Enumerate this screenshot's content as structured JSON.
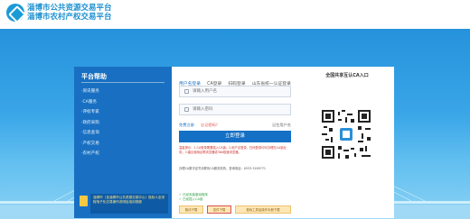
{
  "header": {
    "title_line1": "淄博市公共资源交易平台",
    "title_line2": "淄博市农村产权交易平台"
  },
  "sidebar": {
    "title": "平台帮助",
    "items": [
      {
        "label": "·资讯服务"
      },
      {
        "label": "·CA服务"
      },
      {
        "label": "·评标专家"
      },
      {
        "label": "·政府采购"
      },
      {
        "label": "·信息查询"
      },
      {
        "label": "·产权交易"
      },
      {
        "label": "·农村产权"
      }
    ],
    "notice": "淄博市（含淄博市公共资源交易中心）投标人全流程电子化交易操作说明及培训视频"
  },
  "login": {
    "tabs": [
      {
        "label": "用户名登录",
        "active": true
      },
      {
        "label": "CA登录",
        "active": false
      },
      {
        "label": "扫码登录",
        "active": false
      },
      {
        "label": "山东省统一认证登录",
        "active": false
      }
    ],
    "username_placeholder": "请输入用户名",
    "password_placeholder": "请输入密码",
    "register_link": "免费注册",
    "forgot_link": "忘记密码？",
    "remember_label": "记住用户名",
    "submit_label": "立即登录",
    "note1": "温馨提示：1.CA登录需要插入CA锁；2.用户名登录、扫码登录均可办理无CA锁业务；3.建议使用谷歌浏览器或360极速浏览器。",
    "note2": "办理CA数字证书请联系CA服务机构，咨询电话：0533-3189771",
    "checks": [
      "✓ 已经安装驱动程序",
      "✓ 已经插入CA锁"
    ],
    "downloads": [
      {
        "label": "驱动下载"
      },
      {
        "label": "控件下载"
      },
      {
        "label": "投标工具及操作手册下载"
      }
    ]
  },
  "qr": {
    "title": "全国共享互认CA入口"
  },
  "colors": {
    "nav_bg": "#1970c2",
    "primary": "#1470c4",
    "title_blue": "#1a8fd0",
    "bg_top": "#2592dc",
    "bg_bottom": "#8ad2f4"
  }
}
